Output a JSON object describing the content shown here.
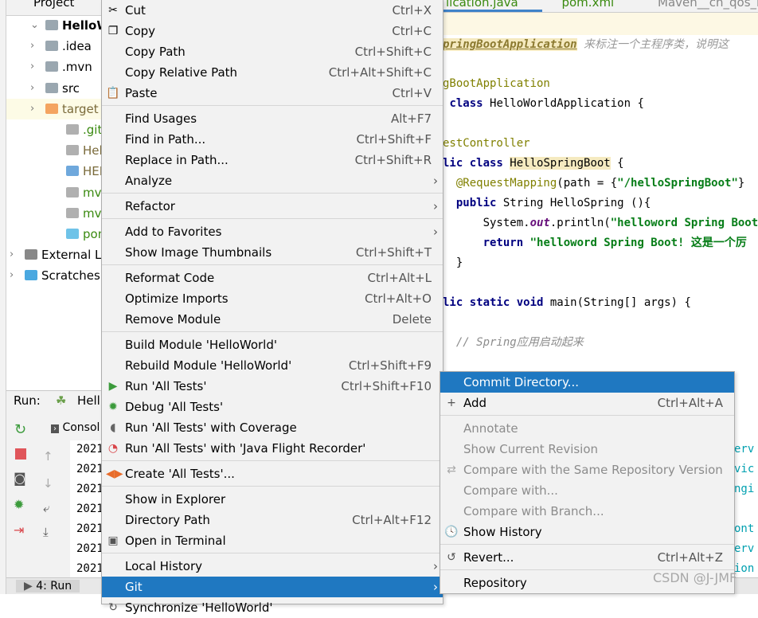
{
  "project": {
    "header": "Project",
    "items": [
      {
        "label": "HelloWor",
        "chev": "⌄",
        "icon": "module-folder-icon",
        "color": "#9aa7b0",
        "bold": true,
        "depth": 0
      },
      {
        "label": ".idea",
        "chev": "›",
        "icon": "folder-icon",
        "color": "#9aa7b0",
        "depth": 1
      },
      {
        "label": ".mvn",
        "chev": "›",
        "icon": "folder-icon",
        "color": "#9aa7b0",
        "depth": 1
      },
      {
        "label": "src",
        "chev": "›",
        "icon": "folder-icon",
        "color": "#9aa7b0",
        "depth": 1
      },
      {
        "label": "target",
        "chev": "›",
        "icon": "folder-icon",
        "color": "#f4a460",
        "depth": 1,
        "text": "#7a6a3a",
        "bg": "#fdfbe6"
      },
      {
        "label": ".gitign",
        "icon": "ignored-file-icon",
        "color": "#b0b0b0",
        "depth": 2,
        "text": "#3a8a10"
      },
      {
        "label": "HelloV",
        "icon": "file-icon",
        "color": "#b0b0b0",
        "depth": 2,
        "text": "#7a6a3a"
      },
      {
        "label": "HELP.",
        "icon": "markdown-file-icon",
        "color": "#6fa8dc",
        "depth": 2,
        "text": "#7a6a3a"
      },
      {
        "label": "mvnw",
        "icon": "script-file-icon",
        "color": "#b0b0b0",
        "depth": 2,
        "text": "#3a8a10"
      },
      {
        "label": "mvnw",
        "icon": "text-file-icon",
        "color": "#b0b0b0",
        "depth": 2,
        "text": "#3a8a10"
      },
      {
        "label": "pom.x",
        "icon": "maven-icon",
        "color": "#6fc3e8",
        "depth": 2,
        "text": "#3a8a10"
      },
      {
        "label": "External L",
        "chev": "›",
        "icon": "library-icon",
        "color": "#888",
        "depth": -1
      },
      {
        "label": "Scratches",
        "chev": "›",
        "icon": "scratches-icon",
        "color": "#4aa8e0",
        "depth": -1
      }
    ]
  },
  "editor": {
    "tabs": [
      "lication.java",
      "pom.xml",
      "Maven__ch_qos_lo"
    ],
    "doc_annotation": "pringBootApplication",
    "doc_comment": "来标注一个主程序类，说明这",
    "lines": [
      {
        "html": "<span class='an'>gBootApplication</span>"
      },
      {
        "html": " <span class='kw'>class</span> HelloWorldApplication {"
      },
      {
        "html": ""
      },
      {
        "html": "<span class='an'>estController</span>"
      },
      {
        "html": "<span class='kw'>lic class</span> <span style='background:#f5eac0'>HelloSpringBoot</span> {"
      },
      {
        "html": "  <span class='an'>@RequestMapping</span>(path = {<span class='st'>\"/helloSpringBoot\"</span>}"
      },
      {
        "html": "  <span class='kw'>public</span> String HelloSpring (){"
      },
      {
        "html": "      System.<i style='color:#660e7a;font-weight:bold'>out</i>.println(<span class='st'>\"helloword Spring Boot</span>"
      },
      {
        "html": "      <span class='kw'>return</span> <span class='st'>\"helloword Spring Boot! 这是一个厉</span>"
      },
      {
        "html": "  }"
      },
      {
        "html": ""
      },
      {
        "html": "<span class='kw'>lic static void</span> main(String[] args) {"
      },
      {
        "html": ""
      },
      {
        "html": "  <span class='cm'>// Spring应用启动起来</span>"
      }
    ]
  },
  "run": {
    "label": "Run:",
    "tab": "Hell",
    "console_tab": "Consol",
    "log_prefix": "2021",
    "rows": 7,
    "bottom_tab": "4: Run"
  },
  "menu": [
    {
      "label": "Cut",
      "shortcut": "Ctrl+X",
      "icon": "scissors-icon",
      "glyph": "✂"
    },
    {
      "label": "Copy",
      "shortcut": "Ctrl+C",
      "icon": "copy-icon",
      "glyph": "❐"
    },
    {
      "label": "Copy Path",
      "shortcut": "Ctrl+Shift+C"
    },
    {
      "label": "Copy Relative Path",
      "shortcut": "Ctrl+Alt+Shift+C"
    },
    {
      "label": "Paste",
      "shortcut": "Ctrl+V",
      "icon": "clipboard-icon",
      "glyph": "📋"
    },
    {
      "sep": true
    },
    {
      "label": "Find Usages",
      "shortcut": "Alt+F7"
    },
    {
      "label": "Find in Path...",
      "shortcut": "Ctrl+Shift+F"
    },
    {
      "label": "Replace in Path...",
      "shortcut": "Ctrl+Shift+R"
    },
    {
      "label": "Analyze",
      "submenu": true
    },
    {
      "sep": true
    },
    {
      "label": "Refactor",
      "submenu": true
    },
    {
      "sep": true
    },
    {
      "label": "Add to Favorites",
      "submenu": true
    },
    {
      "label": "Show Image Thumbnails",
      "shortcut": "Ctrl+Shift+T"
    },
    {
      "sep": true
    },
    {
      "label": "Reformat Code",
      "shortcut": "Ctrl+Alt+L"
    },
    {
      "label": "Optimize Imports",
      "shortcut": "Ctrl+Alt+O"
    },
    {
      "label": "Remove Module",
      "shortcut": "Delete"
    },
    {
      "sep": true
    },
    {
      "label": "Build Module 'HelloWorld'"
    },
    {
      "label": "Rebuild Module 'HelloWorld'",
      "shortcut": "Ctrl+Shift+F9"
    },
    {
      "label": "Run 'All Tests'",
      "shortcut": "Ctrl+Shift+F10",
      "icon": "run-icon",
      "glyph": "▶",
      "color": "#3c9b3c"
    },
    {
      "label": "Debug 'All Tests'",
      "icon": "debug-icon",
      "glyph": "✹",
      "color": "#3c9b3c"
    },
    {
      "label": "Run 'All Tests' with Coverage",
      "icon": "coverage-icon",
      "glyph": "◖",
      "color": "#666"
    },
    {
      "label": "Run 'All Tests' with 'Java Flight Recorder'",
      "icon": "profiler-icon",
      "glyph": "◔",
      "color": "#d9464b"
    },
    {
      "sep": true
    },
    {
      "label": "Create 'All Tests'...",
      "icon": "create-test-icon",
      "glyph": "◀▶",
      "color": "#e86c2b"
    },
    {
      "sep": true
    },
    {
      "label": "Show in Explorer"
    },
    {
      "label": "Directory Path",
      "shortcut": "Ctrl+Alt+F12"
    },
    {
      "label": "Open in Terminal",
      "icon": "terminal-icon",
      "glyph": "▣",
      "color": "#555"
    },
    {
      "sep": true
    },
    {
      "label": "Local History",
      "submenu": true
    },
    {
      "label": "Git",
      "submenu": true,
      "highlighted": true
    },
    {
      "label": "Synchronize 'HelloWorld'",
      "icon": "sync-icon",
      "glyph": "↻",
      "color": "#555"
    }
  ],
  "git_submenu": [
    {
      "label": "Commit Directory...",
      "highlighted": true
    },
    {
      "label": "Add",
      "shortcut": "Ctrl+Alt+A",
      "icon": "plus-icon",
      "glyph": "+",
      "color": "#555"
    },
    {
      "sep": true
    },
    {
      "label": "Annotate",
      "disabled": true
    },
    {
      "label": "Show Current Revision",
      "disabled": true
    },
    {
      "label": "Compare with the Same Repository Version",
      "disabled": true,
      "icon": "compare-icon",
      "glyph": "⇄",
      "color": "#aaa"
    },
    {
      "label": "Compare with...",
      "disabled": true
    },
    {
      "label": "Compare with Branch...",
      "disabled": true
    },
    {
      "label": "Show History",
      "icon": "clock-icon",
      "glyph": "🕓",
      "color": "#555"
    },
    {
      "sep": true
    },
    {
      "label": "Revert...",
      "shortcut": "Ctrl+Alt+Z",
      "icon": "revert-icon",
      "glyph": "↺",
      "color": "#555"
    },
    {
      "sep": true
    },
    {
      "label": "Repository",
      "submenu": false
    }
  ],
  "right_fragments": [
    "erv",
    "vic",
    "ngi",
    "",
    "ont",
    "erv",
    "ion"
  ],
  "watermark": "CSDN @J-JMF",
  "colors": {
    "highlight": "#1f78c1",
    "menu_bg": "#f2f2f2",
    "keyword": "#000080",
    "string": "#067d17"
  }
}
